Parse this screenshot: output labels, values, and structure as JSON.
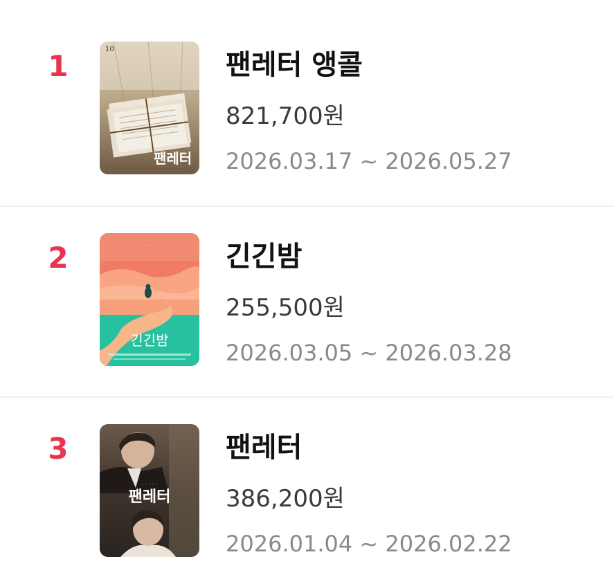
{
  "accent_color": "#e8344e",
  "items": [
    {
      "rank": "1",
      "title": "팬레터 앵콜",
      "price": "821,700원",
      "period": "2026.03.17 ~ 2026.05.27",
      "poster": {
        "icon": "letters-bundle-poster",
        "logo_text": "팬레터"
      }
    },
    {
      "rank": "2",
      "title": "긴긴밤",
      "price": "255,500원",
      "period": "2026.03.05 ~ 2026.03.28",
      "poster": {
        "icon": "penguin-sunset-poster",
        "logo_text": "긴긴밤"
      }
    },
    {
      "rank": "3",
      "title": "팬레터",
      "price": "386,200원",
      "period": "2026.01.04 ~ 2026.02.22",
      "poster": {
        "icon": "actors-portrait-poster",
        "logo_text": "팬레터"
      }
    }
  ]
}
